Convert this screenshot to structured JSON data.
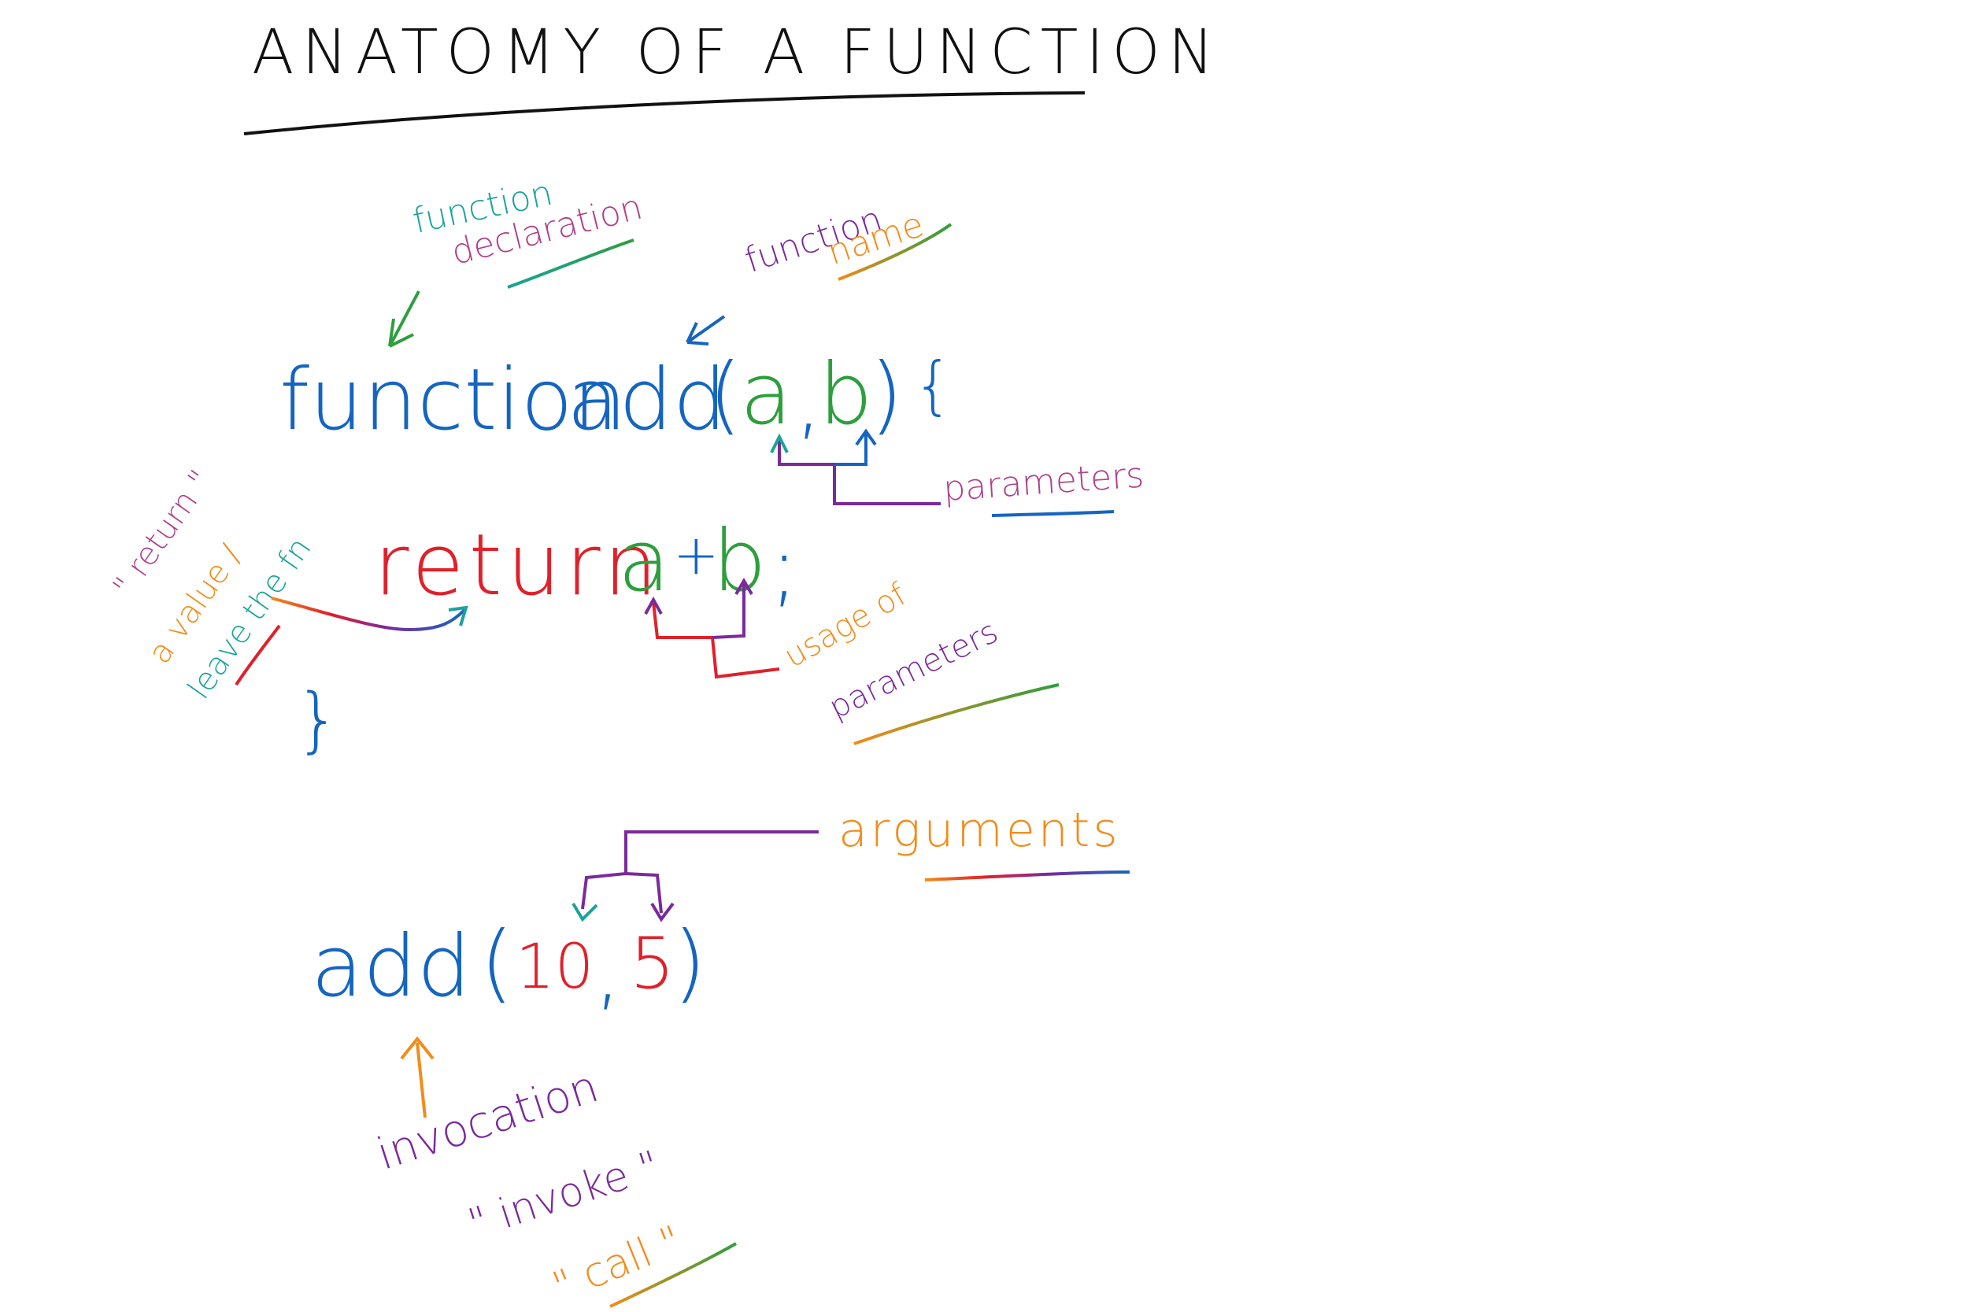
{
  "title": "ANATOMY OF A FUNCTION",
  "colors": {
    "blue": "#1565c0",
    "green": "#2e9e3e",
    "red": "#e0202a",
    "purple": "#7b2a9b",
    "orange": "#f28c1a",
    "teal": "#1aa39a",
    "black": "#111111"
  },
  "code": {
    "keyword_function": "function",
    "fn_name": "add",
    "open_paren": "(",
    "param_a": "a",
    "comma": ",",
    "param_b": "b",
    "close_paren": ")",
    "open_brace": "{",
    "return_kw": "return",
    "expr_a": "a",
    "expr_plus": "+",
    "expr_b": "b",
    "semicolon": ";",
    "close_brace": "}",
    "call_name": "add",
    "call_open": "(",
    "arg_1": "10",
    "call_comma": ",",
    "arg_2": "5",
    "call_close": ")"
  },
  "labels": {
    "function_declaration_1": "function",
    "function_declaration_2": "declaration",
    "function_name_1": "function",
    "function_name_2": "name",
    "parameters": "parameters",
    "usage_1": "usage of",
    "usage_2": "parameters",
    "return_note_1": "\" return \"",
    "return_note_2": "a value /",
    "return_note_3": "leave the fn",
    "arguments": "arguments",
    "invocation": "invocation",
    "invoke": "\" invoke \"",
    "call": "\" call \""
  }
}
